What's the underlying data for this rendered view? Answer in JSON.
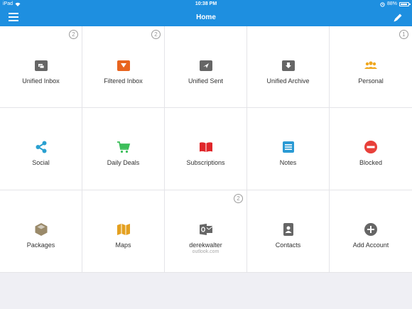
{
  "status_bar": {
    "carrier": "iPad",
    "time": "10:38 PM",
    "battery": "88%",
    "battery_level": 0.88
  },
  "nav": {
    "title": "Home",
    "menu_icon": "hamburger-icon",
    "edit_icon": "pencil-icon"
  },
  "tiles": [
    {
      "label": "Unified Inbox",
      "badge": "2",
      "icon": "inbox-stack-icon",
      "color": "#666666"
    },
    {
      "label": "Filtered Inbox",
      "badge": "2",
      "icon": "filter-inbox-icon",
      "color": "#e8641f"
    },
    {
      "label": "Unified Sent",
      "icon": "sent-tray-icon",
      "color": "#666666"
    },
    {
      "label": "Unified Archive",
      "icon": "archive-icon",
      "color": "#666666"
    },
    {
      "label": "Personal",
      "badge": "1",
      "icon": "people-icon",
      "color": "#f0a820"
    },
    {
      "label": "Social",
      "icon": "share-icon",
      "color": "#2aa0d0"
    },
    {
      "label": "Daily Deals",
      "icon": "cart-icon",
      "color": "#3cbe5a"
    },
    {
      "label": "Subscriptions",
      "icon": "book-icon",
      "color": "#e0262a"
    },
    {
      "label": "Notes",
      "icon": "notes-icon",
      "color": "#2a9ad4"
    },
    {
      "label": "Blocked",
      "icon": "blocked-icon",
      "color": "#e8403a"
    },
    {
      "label": "Packages",
      "icon": "package-icon",
      "color": "#9a8a6a"
    },
    {
      "label": "Maps",
      "icon": "map-icon",
      "color": "#e4a020"
    },
    {
      "label": "derekwalter",
      "sublabel": "outlook.com",
      "badge": "2",
      "icon": "outlook-icon",
      "color": "#666666"
    },
    {
      "label": "Contacts",
      "icon": "contacts-icon",
      "color": "#666666"
    },
    {
      "label": "Add Account",
      "icon": "add-circle-icon",
      "color": "#666666"
    }
  ]
}
